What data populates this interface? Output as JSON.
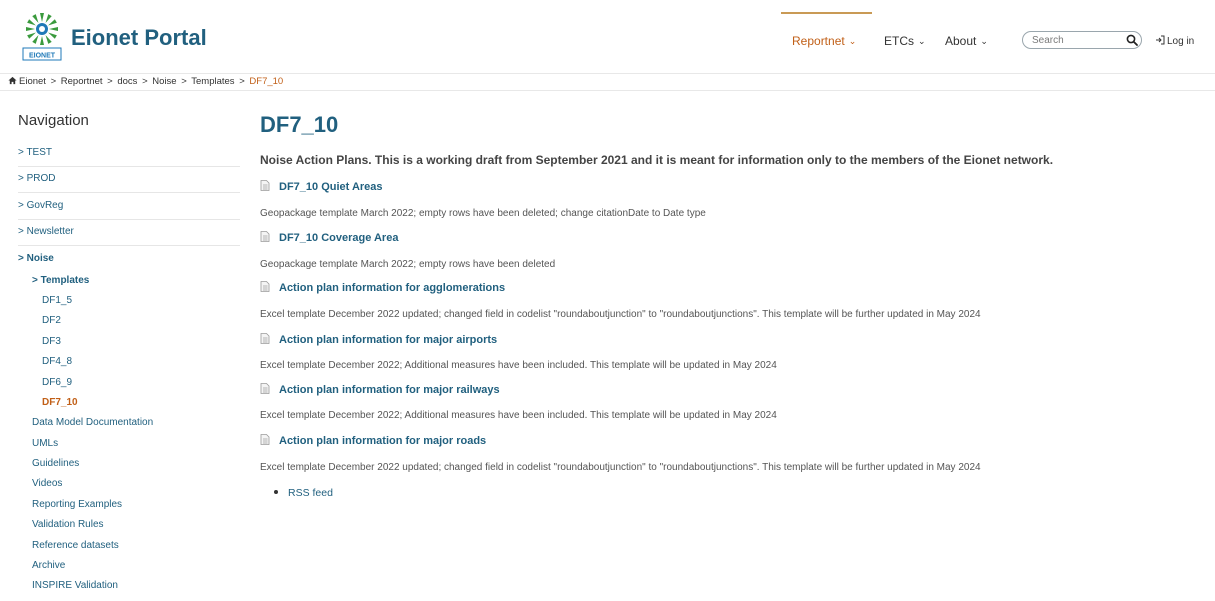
{
  "header": {
    "brand": "Eionet Portal",
    "logo_text": "EIONET",
    "nav": [
      {
        "label": "Reportnet"
      },
      {
        "label": "ETCs"
      },
      {
        "label": "About"
      }
    ],
    "search": {
      "placeholder": "Search"
    },
    "login_label": "Log in"
  },
  "breadcrumb": {
    "items": [
      "Eionet",
      "Reportnet",
      "docs",
      "Noise",
      "Templates"
    ],
    "current": "DF7_10",
    "separator": ">"
  },
  "sidebar": {
    "heading": "Navigation",
    "top_items": [
      "> TEST",
      "> PROD",
      "> GovReg",
      "> Newsletter",
      "> Noise"
    ],
    "templates_label": "> Templates",
    "template_items": [
      "DF1_5",
      "DF2",
      "DF3",
      "DF4_8",
      "DF6_9",
      "DF7_10"
    ],
    "noise_items": [
      "Data Model Documentation",
      "UMLs",
      "Guidelines",
      "Videos",
      "Reporting Examples",
      "Validation Rules",
      "Reference datasets",
      "Archive",
      "INSPIRE Validation"
    ]
  },
  "main": {
    "title": "DF7_10",
    "intro": "Noise Action Plans. This is a working draft from September 2021 and it is meant for information only to the members of the Eionet network.",
    "files": [
      {
        "title": "DF7_10 Quiet Areas",
        "description": "Geopackage template March 2022; empty rows have been deleted; change citationDate to Date type"
      },
      {
        "title": "DF7_10 Coverage Area",
        "description": "Geopackage template March 2022; empty rows have been deleted"
      },
      {
        "title": "Action plan information for agglomerations",
        "description": "Excel template December 2022 updated; changed field in codelist \"roundaboutjunction\" to \"roundaboutjunctions\". This template will be further updated in May 2024"
      },
      {
        "title": "Action plan information for major airports",
        "description": "Excel template December 2022; Additional measures have been included. This template will be updated in May 2024"
      },
      {
        "title": "Action plan information for major railways",
        "description": "Excel template December 2022; Additional measures have been included. This template will be updated in May 2024"
      },
      {
        "title": "Action plan information for major roads",
        "description": "Excel template December 2022 updated; changed field in codelist \"roundaboutjunction\" to \"roundaboutjunctions\". This template will be further updated in May 2024"
      }
    ],
    "rss_label": "RSS feed"
  },
  "colors": {
    "brand_blue": "#21607f",
    "active_orange": "#c15f17",
    "logo_green": "#3a9a3d",
    "logo_blue": "#1f79b8"
  },
  "icons": [
    "eionet-logo",
    "chevron-down-icon",
    "search-icon",
    "login-icon",
    "home-icon",
    "document-icon",
    "bullet-icon"
  ]
}
